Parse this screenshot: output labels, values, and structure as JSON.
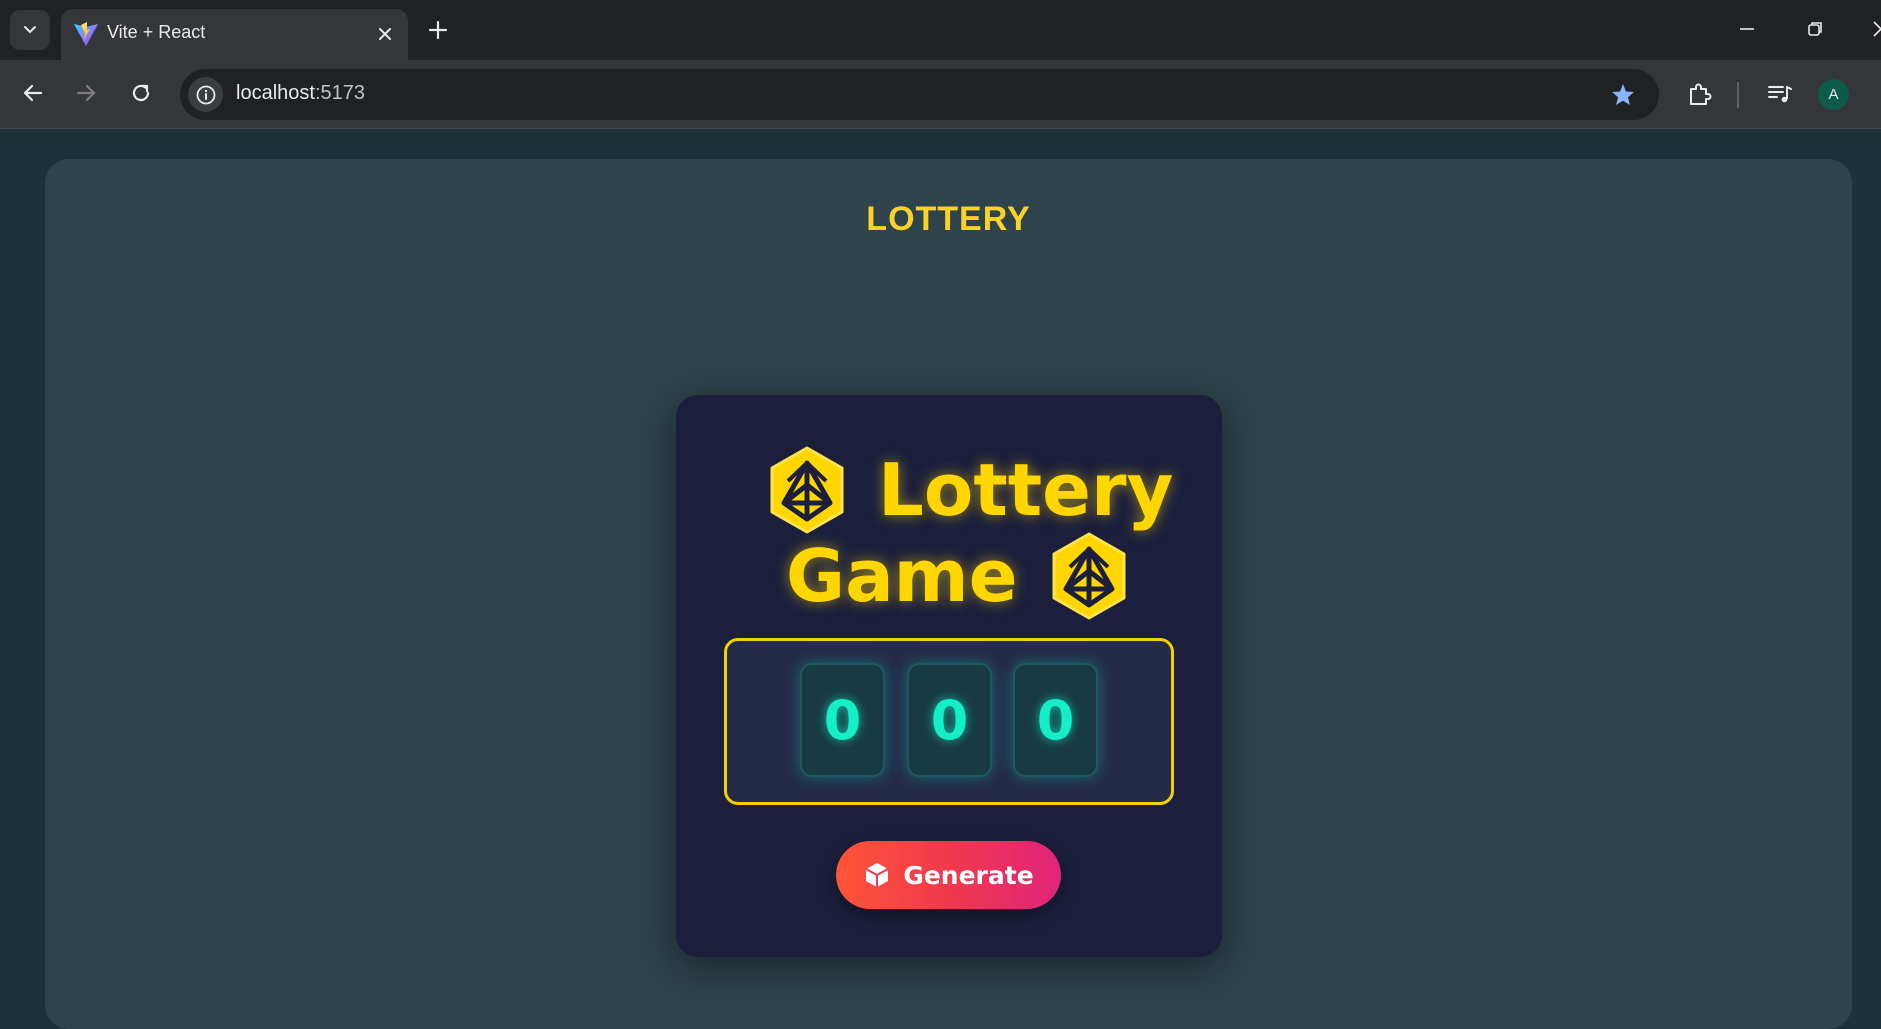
{
  "browser": {
    "tab_title": "Vite + React",
    "url_host": "localhost",
    "url_port": ":5173",
    "profile_initial": "A"
  },
  "page": {
    "heading": "LOTTERY",
    "game_title_line1": "Lottery",
    "game_title_line2": "Game",
    "digits": [
      "0",
      "0",
      "0"
    ],
    "generate_label": "Generate"
  },
  "colors": {
    "page_background": "#1c3138",
    "panel": "#2e434c",
    "heading": "#fcd12a",
    "card": "#1b1f3b",
    "title": "#ffd600",
    "digit_text": "#14efc6",
    "button_gradient_start": "#ff5438",
    "button_gradient_end": "#e0247a"
  },
  "icons": {
    "tab_favicon": "vite-logo-icon",
    "title_die": "d20-die-icon",
    "generate": "cube-icon"
  }
}
